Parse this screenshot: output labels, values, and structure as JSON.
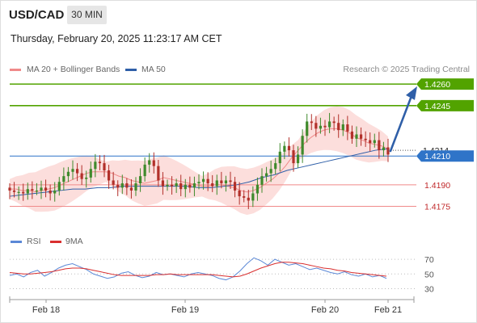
{
  "header": {
    "symbol": "USD/CAD",
    "timeframe": "30 MIN",
    "timestamp": "Thursday, February 20, 2025 11:23:17 AM CET"
  },
  "legend": {
    "ma20_label": "MA 20 + Bollinger Bands",
    "ma50_label": "MA 50",
    "credit": "Research © 2025 Trading Central",
    "rsi_label": "RSI",
    "rsi_ma_label": "9MA"
  },
  "colors": {
    "ma20": "#f08a8a",
    "band_fill": "#fbd3d0",
    "ma50": "#2f5fa8",
    "resistance": "#52a300",
    "support": "#f08a8a",
    "pivot": "#2f74c8",
    "arrow": "#2f5fa8",
    "candle_up": "#3f8a2c",
    "candle_down": "#b2302a",
    "rsi": "#5b88d6",
    "rsi_ma": "#d92f2f"
  },
  "chart_data": [
    {
      "type": "candlestick",
      "title": "USD/CAD 30 MIN",
      "x_tick_labels": [
        "Feb 18",
        "Feb 19",
        "Feb 20",
        "Feb 21"
      ],
      "ylim": [
        1.4168,
        1.4264
      ],
      "levels": [
        {
          "value": 1.426,
          "label": "1.4260",
          "kind": "resistance"
        },
        {
          "value": 1.4245,
          "label": "1.4245",
          "kind": "resistance"
        },
        {
          "value": 1.421,
          "label": "1.4210",
          "kind": "pivot"
        },
        {
          "value": 1.419,
          "label": "1.4190",
          "kind": "support"
        },
        {
          "value": 1.4175,
          "label": "1.4175",
          "kind": "support"
        }
      ],
      "current_price": {
        "value": 1.4214,
        "label": "1.4214"
      },
      "close_series": [
        1.4186,
        1.4185,
        1.4185,
        1.4184,
        1.4187,
        1.4186,
        1.4186,
        1.4188,
        1.4186,
        1.4184,
        1.4186,
        1.4192,
        1.4196,
        1.4199,
        1.4201,
        1.4198,
        1.4194,
        1.4195,
        1.4201,
        1.4206,
        1.4205,
        1.42,
        1.4193,
        1.419,
        1.4188,
        1.4191,
        1.4188,
        1.4186,
        1.4191,
        1.4196,
        1.4204,
        1.4207,
        1.4203,
        1.4193,
        1.4189,
        1.419,
        1.4189,
        1.4191,
        1.4187,
        1.419,
        1.4188,
        1.4191,
        1.4192,
        1.4194,
        1.4191,
        1.4189,
        1.4193,
        1.4191,
        1.4193,
        1.4192,
        1.4186,
        1.4182,
        1.4181,
        1.4179,
        1.4184,
        1.419,
        1.4196,
        1.4198,
        1.4201,
        1.4205,
        1.4213,
        1.4217,
        1.4214,
        1.4205,
        1.4211,
        1.4224,
        1.4234,
        1.4233,
        1.4229,
        1.4231,
        1.423,
        1.4234,
        1.4233,
        1.4228,
        1.4232,
        1.4227,
        1.4222,
        1.4225,
        1.4222,
        1.4221,
        1.4219,
        1.4221,
        1.4214,
        1.4216,
        1.4211
      ],
      "ma20_series": [
        1.4187,
        1.4187,
        1.4186,
        1.4186,
        1.4185,
        1.4186,
        1.4187,
        1.4188,
        1.419,
        1.4192,
        1.4194,
        1.4196,
        1.4198,
        1.4199,
        1.4199,
        1.4199,
        1.4198,
        1.4196,
        1.4195,
        1.4193,
        1.4192,
        1.4191,
        1.4192,
        1.4193,
        1.4195,
        1.4194,
        1.4193,
        1.4192,
        1.4191,
        1.419,
        1.4189,
        1.4189,
        1.419,
        1.419,
        1.4189,
        1.4188,
        1.4186,
        1.4185,
        1.4186,
        1.4188,
        1.4191,
        1.4194,
        1.4198,
        1.4203,
        1.4209,
        1.4214,
        1.4219,
        1.4223,
        1.4226,
        1.4228,
        1.4229,
        1.4229,
        1.4228,
        1.4226,
        1.4223,
        1.4221,
        1.4219,
        1.4218,
        1.4217,
        1.4215
      ],
      "ma50_series": [
        1.4182,
        1.4183,
        1.4184,
        1.4185,
        1.4186,
        1.4187,
        1.4187,
        1.4188,
        1.4188,
        1.4189,
        1.4189,
        1.4189,
        1.4189,
        1.4189,
        1.4189,
        1.4188,
        1.4188,
        1.4189,
        1.419,
        1.4192,
        1.4195,
        1.4197,
        1.42,
        1.4202,
        1.4204,
        1.4206,
        1.4208,
        1.421,
        1.4212,
        1.4214,
        1.4215
      ],
      "projection": {
        "from": 1.4214,
        "to": 1.4259
      }
    },
    {
      "type": "line",
      "title": "RSI",
      "series": [
        {
          "name": "RSI",
          "values": [
            48,
            50,
            46,
            52,
            55,
            47,
            52,
            58,
            62,
            64,
            60,
            56,
            50,
            47,
            44,
            46,
            51,
            53,
            48,
            45,
            47,
            52,
            49,
            50,
            48,
            46,
            50,
            52,
            50,
            48,
            44,
            42,
            46,
            54,
            64,
            72,
            68,
            62,
            70,
            66,
            62,
            64,
            60,
            56,
            58,
            55,
            52,
            50,
            53,
            49,
            47,
            50,
            46,
            48,
            44
          ]
        },
        {
          "name": "9MA",
          "values": [
            52,
            51,
            50,
            50,
            51,
            52,
            53,
            55,
            57,
            58,
            58,
            57,
            55,
            53,
            51,
            49,
            48,
            48,
            48,
            48,
            48,
            49,
            49,
            50,
            49,
            49,
            49,
            49,
            49,
            49,
            48,
            47,
            46,
            47,
            50,
            54,
            58,
            61,
            64,
            66,
            66,
            65,
            64,
            62,
            60,
            58,
            57,
            55,
            54,
            52,
            51,
            50,
            49,
            48,
            47
          ]
        }
      ],
      "y_ticks": [
        70,
        50,
        30
      ],
      "ylim": [
        25,
        80
      ]
    }
  ]
}
